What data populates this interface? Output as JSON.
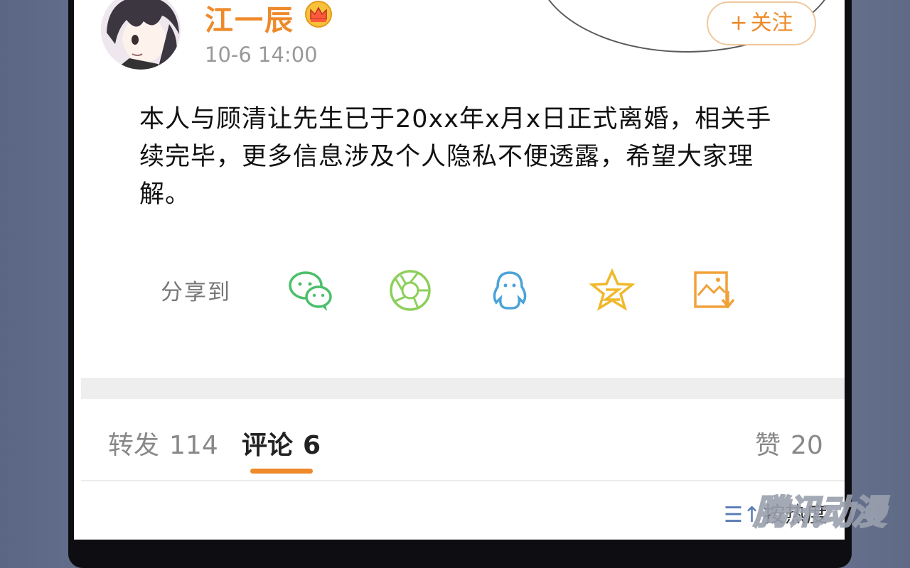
{
  "post": {
    "username": "江一辰",
    "timestamp": "10-6 14:00",
    "follow_label": "关注",
    "follow_plus": "+",
    "body": "本人与顾清让先生已于20xx年x月x日正式离婚，相关手续完毕，更多信息涉及个人隐私不便透露，希望大家理解。"
  },
  "share": {
    "label": "分享到",
    "icons": [
      "wechat-icon",
      "moments-icon",
      "qq-icon",
      "qzone-icon",
      "save-image-icon"
    ]
  },
  "tabs": {
    "repost_label": "转发",
    "repost_count": "114",
    "comment_label": "评论",
    "comment_count": "6",
    "like_label": "赞",
    "like_count": "20"
  },
  "sort": {
    "icon": "sort-icon",
    "label": "按热度"
  },
  "watermark": "腾讯动漫",
  "colors": {
    "accent": "#ee8a2a",
    "wechat": "#4cbf6a",
    "moments": "#8ccf5a",
    "qq": "#4aa3d9",
    "qzone": "#f0b82a",
    "save": "#f0a23a"
  }
}
